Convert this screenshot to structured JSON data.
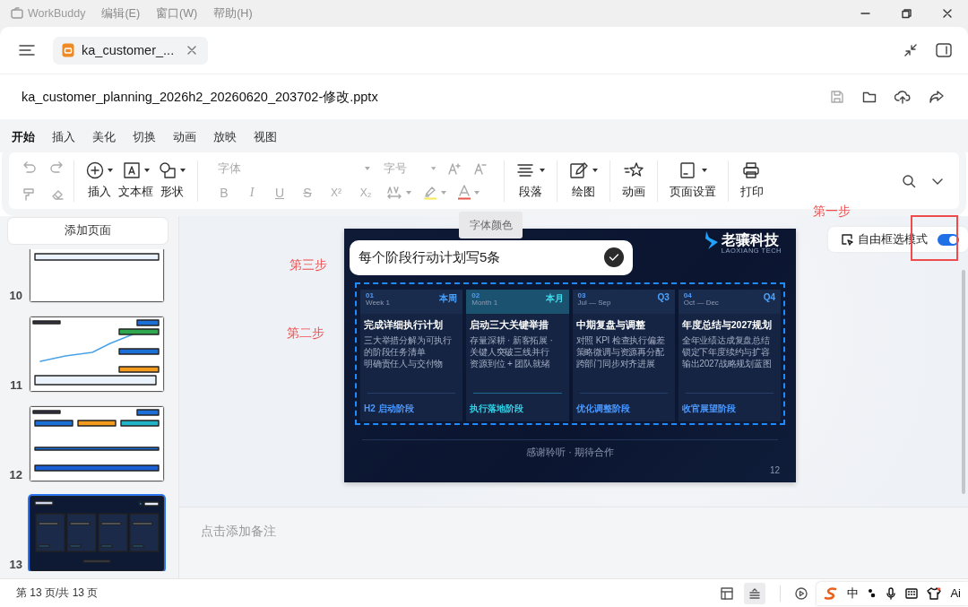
{
  "app": {
    "name": "WorkBuddy",
    "menus": [
      "编辑(E)",
      "窗口(W)",
      "帮助(H)"
    ]
  },
  "doc_tab": {
    "label": "ka_customer_..."
  },
  "file_title": "ka_customer_planning_2026h2_20260620_203702-修改.pptx",
  "ribbon_tabs": [
    {
      "label": "开始",
      "selected": true
    },
    {
      "label": "插入",
      "selected": false
    },
    {
      "label": "美化",
      "selected": false
    },
    {
      "label": "切换",
      "selected": false
    },
    {
      "label": "动画",
      "selected": false
    },
    {
      "label": "放映",
      "selected": false
    },
    {
      "label": "视图",
      "selected": false
    }
  ],
  "toolbar": {
    "insert_buttons": [
      "插入",
      "文本框",
      "形状"
    ],
    "font_field": {
      "placeholder": "字体"
    },
    "size_field": {
      "placeholder": "字号"
    },
    "format_glyphs": [
      "B",
      "I",
      "U",
      "S",
      "X²",
      "X₂"
    ],
    "right_buttons": [
      "段落",
      "绘图",
      "动画",
      "页面设置",
      "打印"
    ]
  },
  "tooltip": "字体颜色",
  "add_page_button": "添加页面",
  "thumbnails": [
    {
      "number": "10",
      "kind": "light",
      "selected": false
    },
    {
      "number": "11",
      "kind": "light",
      "selected": false
    },
    {
      "number": "12",
      "kind": "light",
      "selected": false
    },
    {
      "number": "13",
      "kind": "dark",
      "selected": true
    }
  ],
  "slide": {
    "logo": {
      "name": "老骧科技",
      "subtitle": "LAOXIANG TECH"
    },
    "cards": [
      {
        "index": "01",
        "period": "Week 1",
        "tag": "本周",
        "title": "完成详细执行计划",
        "lines": [
          "三大举措分解为可执行",
          "的阶段任务清单",
          "明确责任人与交付物"
        ],
        "stage": "H2 启动阶段",
        "highlighted": false
      },
      {
        "index": "02",
        "period": "Month 1",
        "tag": "本月",
        "title": "启动三大关键举措",
        "lines": [
          "存量深耕 · 新客拓展 ·",
          "关键人突破三线并行",
          "资源到位 + 团队就绪"
        ],
        "stage": "执行落地阶段",
        "highlighted": true
      },
      {
        "index": "03",
        "period": "Jul — Sep",
        "tag": "Q3",
        "title": "中期复盘与调整",
        "lines": [
          "对照 KPI 检查执行偏差",
          "策略微调与资源再分配",
          "跨部门同步对齐进展"
        ],
        "stage": "优化调整阶段",
        "highlighted": false
      },
      {
        "index": "04",
        "period": "Oct — Dec",
        "tag": "Q4",
        "title": "年度总结与2027规划",
        "lines": [
          "全年业绩达成复盘总结",
          "锁定下年度续约与扩容",
          "输出2027战略规划蓝图"
        ],
        "stage": "收官展望阶段",
        "highlighted": false
      }
    ],
    "footer": "感谢聆听 · 期待合作",
    "page_number": "12"
  },
  "prompt_box": {
    "value": "每个阶段行动计划写5条"
  },
  "mode_toggle": {
    "label": "自由框选模式",
    "on": true
  },
  "annotations": [
    {
      "text": "第一步"
    },
    {
      "text": "第二步"
    },
    {
      "text": "第三步"
    }
  ],
  "notes": {
    "placeholder": "点击添加备注"
  },
  "status_bar": {
    "page_info": "第 13 页/共 13 页"
  },
  "ime_bar": {
    "items": [
      "中",
      "Ai"
    ]
  }
}
